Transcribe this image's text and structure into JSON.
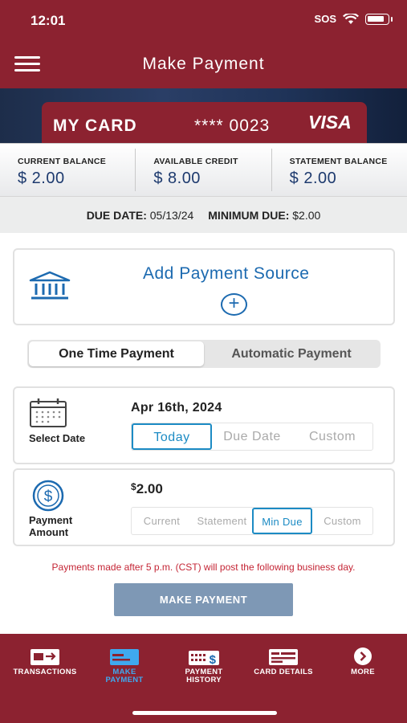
{
  "status": {
    "time": "12:01",
    "signal": "SOS"
  },
  "header": {
    "title": "Make Payment"
  },
  "card": {
    "name": "MY CARD",
    "number": "**** 0023",
    "brand": "VISA"
  },
  "balances": [
    {
      "label": "CURRENT BALANCE",
      "value": "$ 2.00"
    },
    {
      "label": "AVAILABLE CREDIT",
      "value": "$ 8.00"
    },
    {
      "label": "STATEMENT BALANCE",
      "value": "$ 2.00"
    }
  ],
  "due": {
    "date_label": "DUE DATE:",
    "date_value": "05/13/24",
    "min_label": "MINIMUM DUE:",
    "min_value": "$2.00"
  },
  "payment_source": {
    "label": "Add Payment Source",
    "icon": "bank-icon"
  },
  "payment_type": {
    "options": [
      "One Time Payment",
      "Automatic Payment"
    ],
    "selected": "One Time Payment"
  },
  "select_date": {
    "label": "Select Date",
    "value": "Apr 16th, 2024",
    "options": [
      "Today",
      "Due Date",
      "Custom"
    ],
    "selected": "Today"
  },
  "payment_amount": {
    "label_line1": "Payment",
    "label_line2": "Amount",
    "currency": "$",
    "value": "2.00",
    "options": [
      "Current",
      "Statement",
      "Min Due",
      "Custom"
    ],
    "selected": "Min Due"
  },
  "notice": "Payments made after 5 p.m. (CST) will post the following business day.",
  "make_payment_label": "MAKE PAYMENT",
  "tabs": [
    {
      "line1": "TRANSACTIONS",
      "line2": "",
      "icon": "transactions-icon"
    },
    {
      "line1": "MAKE",
      "line2": "PAYMENT",
      "icon": "make-payment-icon"
    },
    {
      "line1": "PAYMENT",
      "line2": "HISTORY",
      "icon": "payment-history-icon"
    },
    {
      "line1": "CARD DETAILS",
      "line2": "",
      "icon": "card-details-icon"
    },
    {
      "line1": "MORE",
      "line2": "",
      "icon": "more-icon"
    }
  ],
  "colors": {
    "brand": "#8c2230",
    "link": "#1c6ab0",
    "selected": "#1c8bc4",
    "active_tab": "#3fa9ef",
    "notice": "#c42535",
    "button": "#7e98b5"
  }
}
